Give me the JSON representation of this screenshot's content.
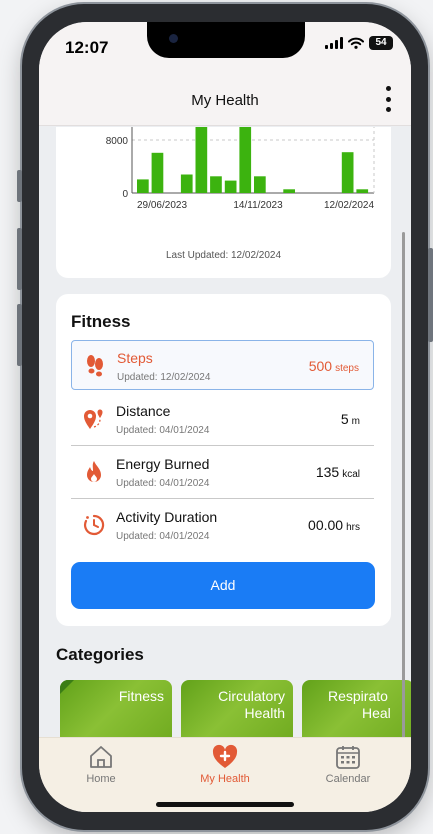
{
  "status": {
    "time": "12:07",
    "battery": "54"
  },
  "header": {
    "title": "My Health"
  },
  "chart_data": {
    "type": "bar",
    "ytick": "8000",
    "ytick0": "0",
    "xtick_labels": [
      "29/06/2023",
      "14/11/2023",
      "12/02/2024"
    ],
    "bar_color": "#3cb30f",
    "values": [
      2200,
      6500,
      0,
      3000,
      11000,
      2700,
      2000,
      11000,
      2700,
      0,
      600,
      0,
      0,
      0,
      6600,
      600
    ],
    "ylim": [
      0,
      11000
    ]
  },
  "chart_updated": "Last Updated: 12/02/2024",
  "fitness": {
    "title": "Fitness",
    "items": [
      {
        "name": "Steps",
        "updated": "Updated: 12/02/2024",
        "value": "500",
        "unit": "steps",
        "icon": "footprints-icon"
      },
      {
        "name": "Distance",
        "updated": "Updated: 04/01/2024",
        "value": "5",
        "unit": "m",
        "icon": "route-pin-icon"
      },
      {
        "name": "Energy Burned",
        "updated": "Updated: 04/01/2024",
        "value": "135",
        "unit": "kcal",
        "icon": "flame-icon"
      },
      {
        "name": "Activity Duration",
        "updated": "Updated: 04/01/2024",
        "value": "00.00",
        "unit": "hrs",
        "icon": "timer-icon"
      }
    ],
    "add_label": "Add"
  },
  "categories": {
    "title": "Categories",
    "items": [
      {
        "label": "Fitness",
        "label2": ""
      },
      {
        "label": "Circulatory",
        "label2": "Health"
      },
      {
        "label": "Respirato",
        "label2": "Heal"
      }
    ]
  },
  "tabs": [
    {
      "label": "Home",
      "icon": "home-icon"
    },
    {
      "label": "My Health",
      "icon": "heart-plus-icon"
    },
    {
      "label": "Calendar",
      "icon": "calendar-icon"
    }
  ],
  "colors": {
    "accent": "#e25a36",
    "primary": "#1a7cf5",
    "bars": "#3cb30f"
  }
}
